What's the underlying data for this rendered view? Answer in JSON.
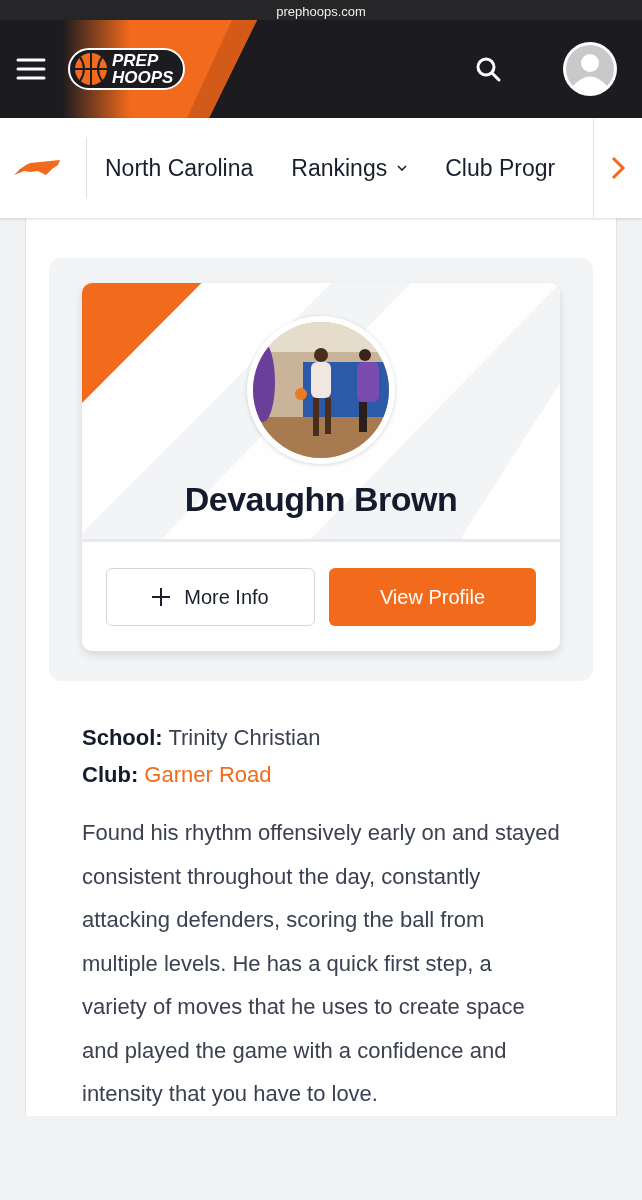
{
  "browser": {
    "address": "prephoops.com"
  },
  "header": {
    "logo": [
      "PREP",
      "HOOPS"
    ]
  },
  "nav": {
    "items": [
      {
        "label": "North Carolina",
        "dropdown": false
      },
      {
        "label": "Rankings",
        "dropdown": true
      },
      {
        "label": "Club Progr",
        "dropdown": false
      }
    ]
  },
  "player": {
    "name": "Devaughn Brown",
    "buttons": [
      "More Info",
      "View Profile"
    ]
  },
  "details": [
    {
      "label": "School:",
      "value": "Trinity Christian",
      "kind": "text"
    },
    {
      "label": "Club:",
      "value": "Garner Road",
      "kind": "link"
    }
  ],
  "description": "Found his rhythm offensively early on and stayed consistent throughout the day, constantly attacking defenders, scoring the ball from multiple levels. He has a quick first step, a variety of moves that he uses to create space and played the game with a confidence and intensity that you have to love."
}
